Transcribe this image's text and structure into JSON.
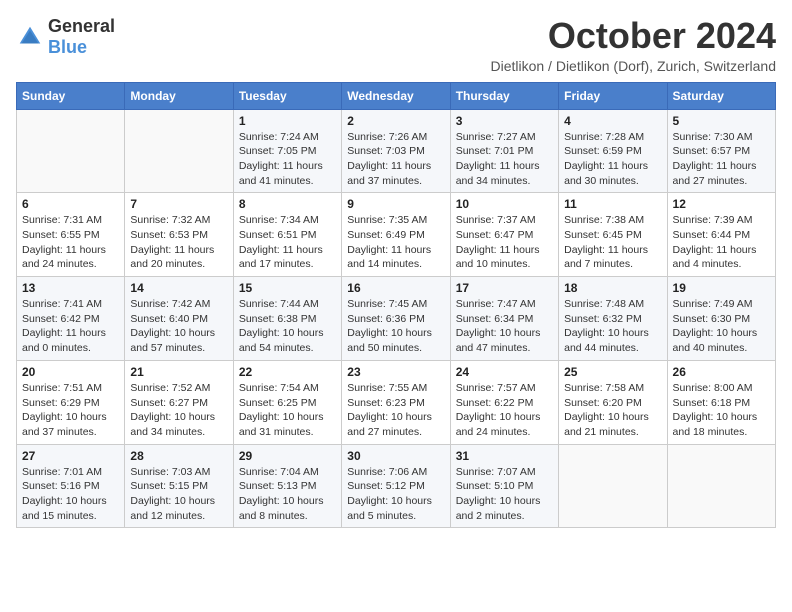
{
  "header": {
    "logo_general": "General",
    "logo_blue": "Blue",
    "month_title": "October 2024",
    "location": "Dietlikon / Dietlikon (Dorf), Zurich, Switzerland"
  },
  "weekdays": [
    "Sunday",
    "Monday",
    "Tuesday",
    "Wednesday",
    "Thursday",
    "Friday",
    "Saturday"
  ],
  "weeks": [
    [
      {
        "day": "",
        "info": ""
      },
      {
        "day": "",
        "info": ""
      },
      {
        "day": "1",
        "info": "Sunrise: 7:24 AM\nSunset: 7:05 PM\nDaylight: 11 hours and 41 minutes."
      },
      {
        "day": "2",
        "info": "Sunrise: 7:26 AM\nSunset: 7:03 PM\nDaylight: 11 hours and 37 minutes."
      },
      {
        "day": "3",
        "info": "Sunrise: 7:27 AM\nSunset: 7:01 PM\nDaylight: 11 hours and 34 minutes."
      },
      {
        "day": "4",
        "info": "Sunrise: 7:28 AM\nSunset: 6:59 PM\nDaylight: 11 hours and 30 minutes."
      },
      {
        "day": "5",
        "info": "Sunrise: 7:30 AM\nSunset: 6:57 PM\nDaylight: 11 hours and 27 minutes."
      }
    ],
    [
      {
        "day": "6",
        "info": "Sunrise: 7:31 AM\nSunset: 6:55 PM\nDaylight: 11 hours and 24 minutes."
      },
      {
        "day": "7",
        "info": "Sunrise: 7:32 AM\nSunset: 6:53 PM\nDaylight: 11 hours and 20 minutes."
      },
      {
        "day": "8",
        "info": "Sunrise: 7:34 AM\nSunset: 6:51 PM\nDaylight: 11 hours and 17 minutes."
      },
      {
        "day": "9",
        "info": "Sunrise: 7:35 AM\nSunset: 6:49 PM\nDaylight: 11 hours and 14 minutes."
      },
      {
        "day": "10",
        "info": "Sunrise: 7:37 AM\nSunset: 6:47 PM\nDaylight: 11 hours and 10 minutes."
      },
      {
        "day": "11",
        "info": "Sunrise: 7:38 AM\nSunset: 6:45 PM\nDaylight: 11 hours and 7 minutes."
      },
      {
        "day": "12",
        "info": "Sunrise: 7:39 AM\nSunset: 6:44 PM\nDaylight: 11 hours and 4 minutes."
      }
    ],
    [
      {
        "day": "13",
        "info": "Sunrise: 7:41 AM\nSunset: 6:42 PM\nDaylight: 11 hours and 0 minutes."
      },
      {
        "day": "14",
        "info": "Sunrise: 7:42 AM\nSunset: 6:40 PM\nDaylight: 10 hours and 57 minutes."
      },
      {
        "day": "15",
        "info": "Sunrise: 7:44 AM\nSunset: 6:38 PM\nDaylight: 10 hours and 54 minutes."
      },
      {
        "day": "16",
        "info": "Sunrise: 7:45 AM\nSunset: 6:36 PM\nDaylight: 10 hours and 50 minutes."
      },
      {
        "day": "17",
        "info": "Sunrise: 7:47 AM\nSunset: 6:34 PM\nDaylight: 10 hours and 47 minutes."
      },
      {
        "day": "18",
        "info": "Sunrise: 7:48 AM\nSunset: 6:32 PM\nDaylight: 10 hours and 44 minutes."
      },
      {
        "day": "19",
        "info": "Sunrise: 7:49 AM\nSunset: 6:30 PM\nDaylight: 10 hours and 40 minutes."
      }
    ],
    [
      {
        "day": "20",
        "info": "Sunrise: 7:51 AM\nSunset: 6:29 PM\nDaylight: 10 hours and 37 minutes."
      },
      {
        "day": "21",
        "info": "Sunrise: 7:52 AM\nSunset: 6:27 PM\nDaylight: 10 hours and 34 minutes."
      },
      {
        "day": "22",
        "info": "Sunrise: 7:54 AM\nSunset: 6:25 PM\nDaylight: 10 hours and 31 minutes."
      },
      {
        "day": "23",
        "info": "Sunrise: 7:55 AM\nSunset: 6:23 PM\nDaylight: 10 hours and 27 minutes."
      },
      {
        "day": "24",
        "info": "Sunrise: 7:57 AM\nSunset: 6:22 PM\nDaylight: 10 hours and 24 minutes."
      },
      {
        "day": "25",
        "info": "Sunrise: 7:58 AM\nSunset: 6:20 PM\nDaylight: 10 hours and 21 minutes."
      },
      {
        "day": "26",
        "info": "Sunrise: 8:00 AM\nSunset: 6:18 PM\nDaylight: 10 hours and 18 minutes."
      }
    ],
    [
      {
        "day": "27",
        "info": "Sunrise: 7:01 AM\nSunset: 5:16 PM\nDaylight: 10 hours and 15 minutes."
      },
      {
        "day": "28",
        "info": "Sunrise: 7:03 AM\nSunset: 5:15 PM\nDaylight: 10 hours and 12 minutes."
      },
      {
        "day": "29",
        "info": "Sunrise: 7:04 AM\nSunset: 5:13 PM\nDaylight: 10 hours and 8 minutes."
      },
      {
        "day": "30",
        "info": "Sunrise: 7:06 AM\nSunset: 5:12 PM\nDaylight: 10 hours and 5 minutes."
      },
      {
        "day": "31",
        "info": "Sunrise: 7:07 AM\nSunset: 5:10 PM\nDaylight: 10 hours and 2 minutes."
      },
      {
        "day": "",
        "info": ""
      },
      {
        "day": "",
        "info": ""
      }
    ]
  ]
}
